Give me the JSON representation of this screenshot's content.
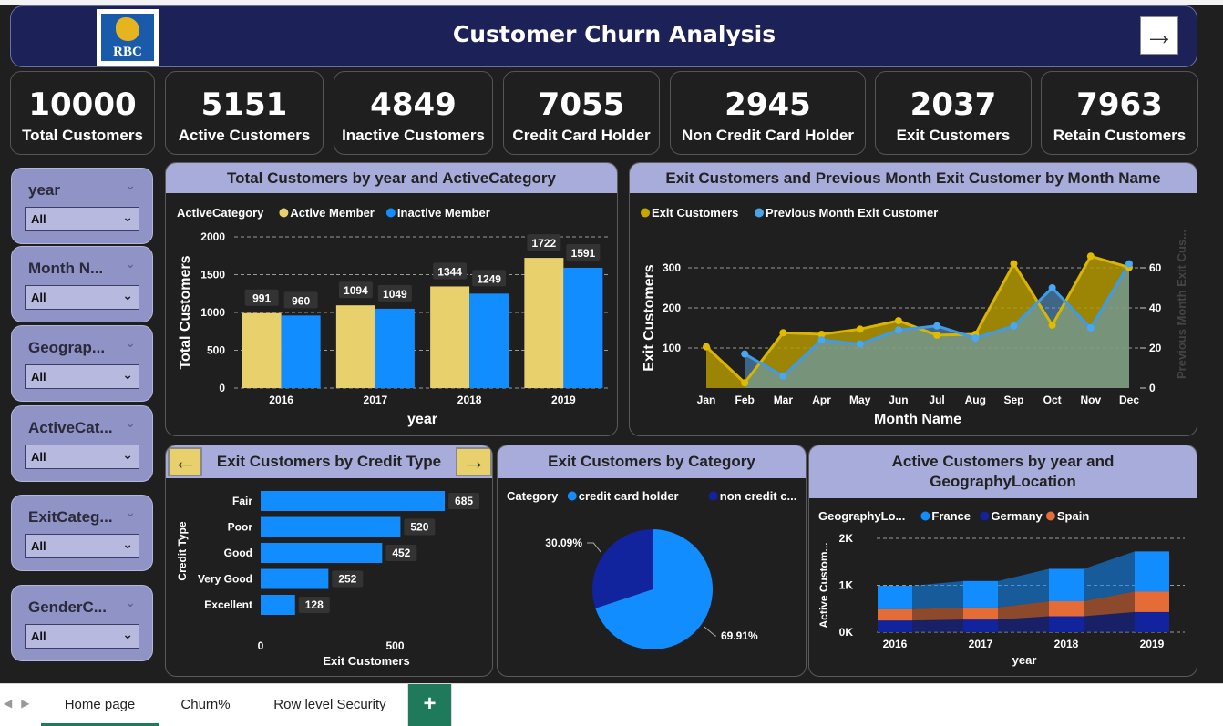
{
  "header": {
    "title": "Customer Churn Analysis",
    "logo_text": "RBC"
  },
  "kpis": [
    {
      "value": "10000",
      "label": "Total Customers"
    },
    {
      "value": "5151",
      "label": "Active Customers"
    },
    {
      "value": "4849",
      "label": "Inactive Customers"
    },
    {
      "value": "7055",
      "label": "Credit Card Holder"
    },
    {
      "value": "2945",
      "label": "Non Credit Card Holder"
    },
    {
      "value": "2037",
      "label": "Exit Customers"
    },
    {
      "value": "7963",
      "label": "Retain Customers"
    }
  ],
  "slicers": [
    {
      "title": "year",
      "value": "All"
    },
    {
      "title": "Month N...",
      "value": "All"
    },
    {
      "title": "Geograp...",
      "value": "All"
    },
    {
      "title": "ActiveCat...",
      "value": "All"
    },
    {
      "title": "ExitCateg...",
      "value": "All"
    },
    {
      "title": "GenderC...",
      "value": "All"
    }
  ],
  "panels": {
    "p1_title": "Total Customers by year and ActiveCategory",
    "p2_title": "Exit Customers and Previous Month Exit Customer by Month Name",
    "p3_title": "Exit Customers by Credit Type",
    "p4_title": "Exit Customers by Category",
    "p5_title_line1": "Active Customers by year and",
    "p5_title_line2": "GeographyLocation"
  },
  "colors": {
    "gold": "#e8d06d",
    "blue": "#118dff",
    "navy": "#12239e",
    "orange": "#e66c37",
    "header_bg": "#1c2257",
    "title_bar": "#a7acdb"
  },
  "chart_data": [
    {
      "type": "bar",
      "title": "Total Customers by year and ActiveCategory",
      "legend_title": "ActiveCategory",
      "categories": [
        "2016",
        "2017",
        "2018",
        "2019"
      ],
      "series": [
        {
          "name": "Active Member",
          "values": [
            991,
            1094,
            1344,
            1722
          ]
        },
        {
          "name": "Inactive Member",
          "values": [
            960,
            1049,
            1249,
            1591
          ]
        }
      ],
      "xlabel": "year",
      "ylabel": "Total Customers",
      "ylim": [
        0,
        2000
      ],
      "yticks": [
        "0",
        "500",
        "1000",
        "1500",
        "2000"
      ]
    },
    {
      "type": "area",
      "title": "Exit Customers and Previous Month Exit Customer by Month Name",
      "categories": [
        "Jan",
        "Feb",
        "Mar",
        "Apr",
        "May",
        "Jun",
        "Jul",
        "Aug",
        "Sep",
        "Oct",
        "Nov",
        "Dec"
      ],
      "series": [
        {
          "name": "Exit Customers",
          "values": [
            103,
            13,
            138,
            134,
            147,
            168,
            132,
            134,
            310,
            157,
            329,
            301
          ]
        },
        {
          "name": "Previous Month Exit Customer",
          "values": [
            null,
            17,
            6,
            24,
            22,
            29,
            31,
            25,
            31,
            50,
            30,
            62
          ]
        }
      ],
      "xlabel": "Month Name",
      "ylabel": "Exit Customers",
      "y2label": "Previous Month Exit Cus...",
      "yticks": [
        "100",
        "200",
        "300"
      ],
      "y2ticks": [
        "0",
        "20",
        "40",
        "60"
      ]
    },
    {
      "type": "bar",
      "orientation": "horizontal",
      "title": "Exit Customers by Credit Type",
      "categories": [
        "Fair",
        "Poor",
        "Good",
        "Very Good",
        "Excellent"
      ],
      "values": [
        685,
        520,
        452,
        252,
        128
      ],
      "xlabel": "Exit Customers",
      "ylabel": "Credit Type",
      "xticks": [
        "0",
        "500"
      ]
    },
    {
      "type": "pie",
      "title": "Exit Customers by Category",
      "legend_title": "Category",
      "labels": [
        "credit card holder",
        "non credit c..."
      ],
      "values": [
        69.91,
        30.09
      ],
      "value_labels": [
        "69.91%",
        "30.09%"
      ]
    },
    {
      "type": "area",
      "stacked": true,
      "title": "Active Customers by year and GeographyLocation",
      "legend_title": "GeographyLo...",
      "categories": [
        "2016",
        "2017",
        "2018",
        "2019"
      ],
      "series": [
        {
          "name": "France",
          "values": [
            500,
            560,
            690,
            850
          ]
        },
        {
          "name": "Germany",
          "values": [
            250,
            270,
            340,
            430
          ]
        },
        {
          "name": "Spain",
          "values": [
            240,
            260,
            320,
            440
          ]
        }
      ],
      "xlabel": "year",
      "ylabel": "Active Custom...",
      "yticks": [
        "0K",
        "1K",
        "2K"
      ]
    }
  ],
  "tabs": [
    {
      "label": "Home page"
    },
    {
      "label": "Churn%"
    },
    {
      "label": "Row level Security"
    },
    {
      "label": "+"
    }
  ]
}
